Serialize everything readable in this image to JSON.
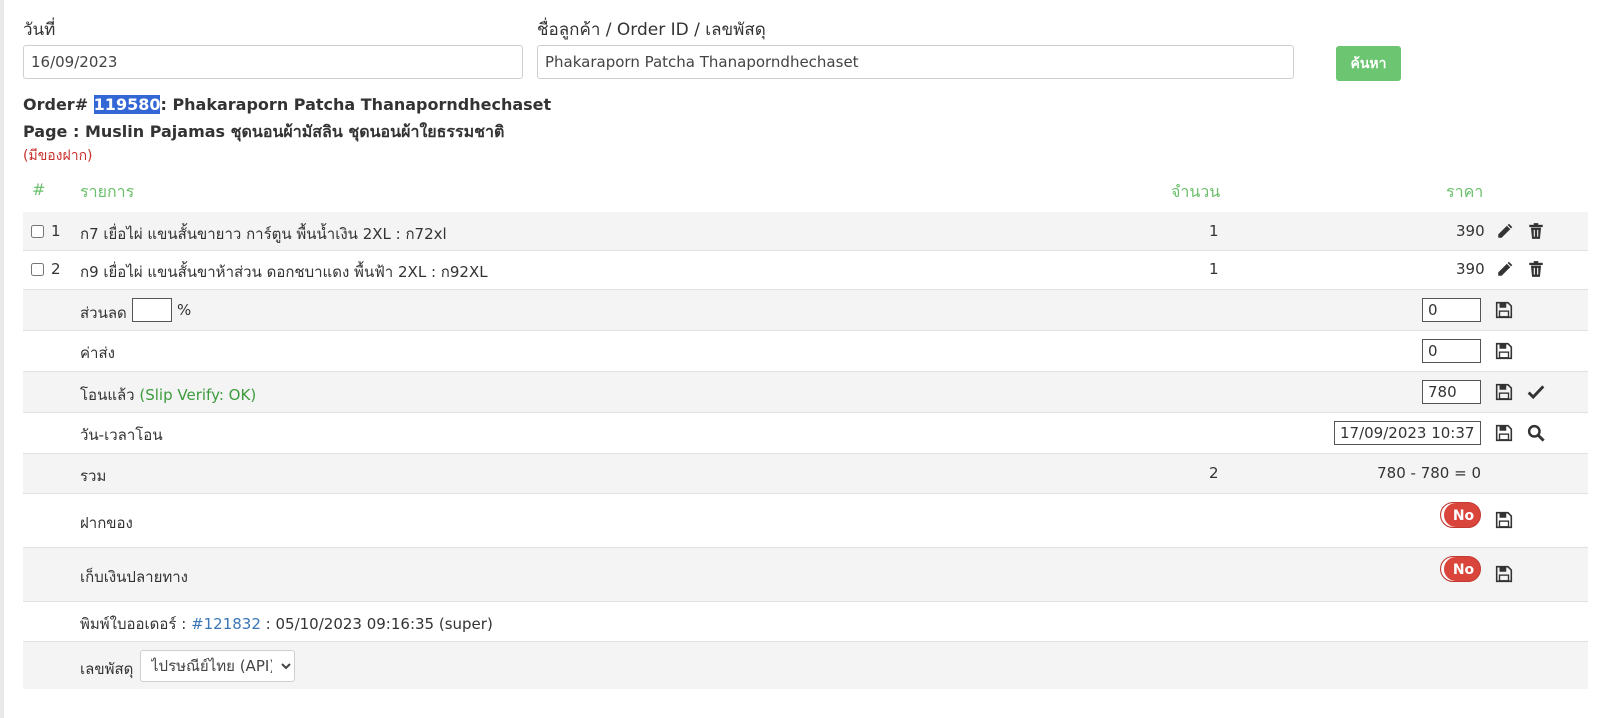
{
  "form": {
    "date_label": "วันที่",
    "date_value": "16/09/2023",
    "customer_label": "ชื่อลูกค้า / Order ID / เลขพัสดุ",
    "customer_value": "Phakaraporn Patcha Thanaporndhechaset",
    "search_button": "ค้นหา"
  },
  "order": {
    "prefix": "Order# ",
    "id": "119580",
    "customer_suffix": ": Phakaraporn Patcha Thanaporndhechaset",
    "page_line": "Page : Muslin Pajamas ชุดนอนผ้ามัสลิน ชุดนอนผ้าใยธรรมชาติ",
    "note": "(มีของฝาก)"
  },
  "table": {
    "headers": {
      "index": "#",
      "item": "รายการ",
      "qty": "จำนวน",
      "price": "ราคา"
    },
    "items": [
      {
        "index": "1",
        "name": "ก7 เยื่อไผ่ แขนสั้นขายาว การ์ตูน พื้นน้ำเงิน 2XL : ก72xl",
        "qty": "1",
        "price": "390"
      },
      {
        "index": "2",
        "name": "ก9 เยื่อไผ่ แขนสั้นขาห้าส่วน ดอกชบาแดง พื้นฟ้า 2XL : ก92XL",
        "qty": "1",
        "price": "390"
      }
    ],
    "discount": {
      "label": "ส่วนลด",
      "percent_value": "",
      "percent_sign": "%",
      "value": "0"
    },
    "shipping": {
      "label": "ค่าส่ง",
      "value": "0"
    },
    "paid": {
      "label": "โอนแล้ว",
      "verify": "(Slip Verify: OK)",
      "value": "780"
    },
    "transfer_time": {
      "label": "วัน-เวลาโอน",
      "value": "17/09/2023 10:37"
    },
    "total": {
      "label": "รวม",
      "qty": "2",
      "formula": "780 - 780 = 0"
    },
    "deposit": {
      "label": "ฝากของ",
      "toggle": "No"
    },
    "cod": {
      "label": "เก็บเงินปลายทาง",
      "toggle": "No"
    },
    "printed": {
      "label": "พิมพ์ใบออเดอร์ : ",
      "link": "#121832",
      "rest": " : 05/10/2023 09:16:35 (super)"
    },
    "tracking": {
      "label": "เลขพัสดุ",
      "selected": "ไปรษณีย์ไทย (API)"
    }
  },
  "colors": {
    "accent_green": "#6cc570",
    "header_green": "#6cbf6c",
    "highlight_blue": "#3367d6",
    "toggle_red": "#d9443b",
    "note_red": "#c9302c",
    "link_blue": "#3a76b4"
  },
  "icons": {
    "edit": "pencil-icon",
    "delete": "trash-icon",
    "save": "floppy-disk-icon",
    "confirm": "check-icon",
    "search": "magnifier-icon"
  }
}
